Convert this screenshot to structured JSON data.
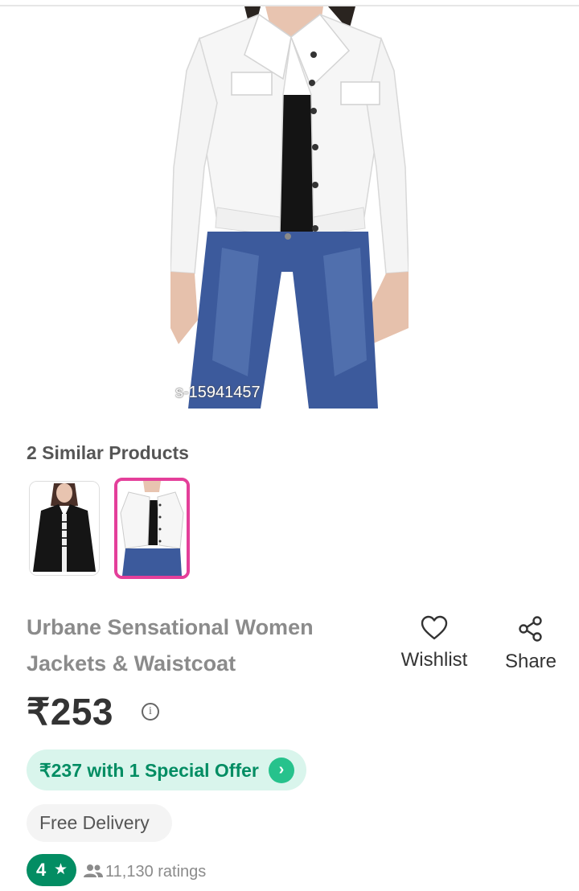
{
  "product_image": {
    "caption": "s-15941457"
  },
  "similar": {
    "title": "2 Similar Products"
  },
  "product": {
    "title": "Urbane Sensational Women Jackets & Waistcoat",
    "price": "₹253",
    "info_glyph": "i"
  },
  "actions": {
    "wishlist_label": "Wishlist",
    "share_label": "Share"
  },
  "offer": {
    "text": "₹237 with 1 Special Offer",
    "chevron": "›"
  },
  "delivery": {
    "label": "Free Delivery"
  },
  "rating": {
    "value": "4",
    "star": "★",
    "count_text": "11,130 ratings"
  },
  "colors": {
    "accent_pink": "#e43f9a",
    "green": "#038d63",
    "offer_bg": "#d9f5ec"
  },
  "icons": [
    "heart-icon",
    "share-icon",
    "info-icon",
    "chevron-right-icon",
    "star-icon",
    "people-icon"
  ]
}
